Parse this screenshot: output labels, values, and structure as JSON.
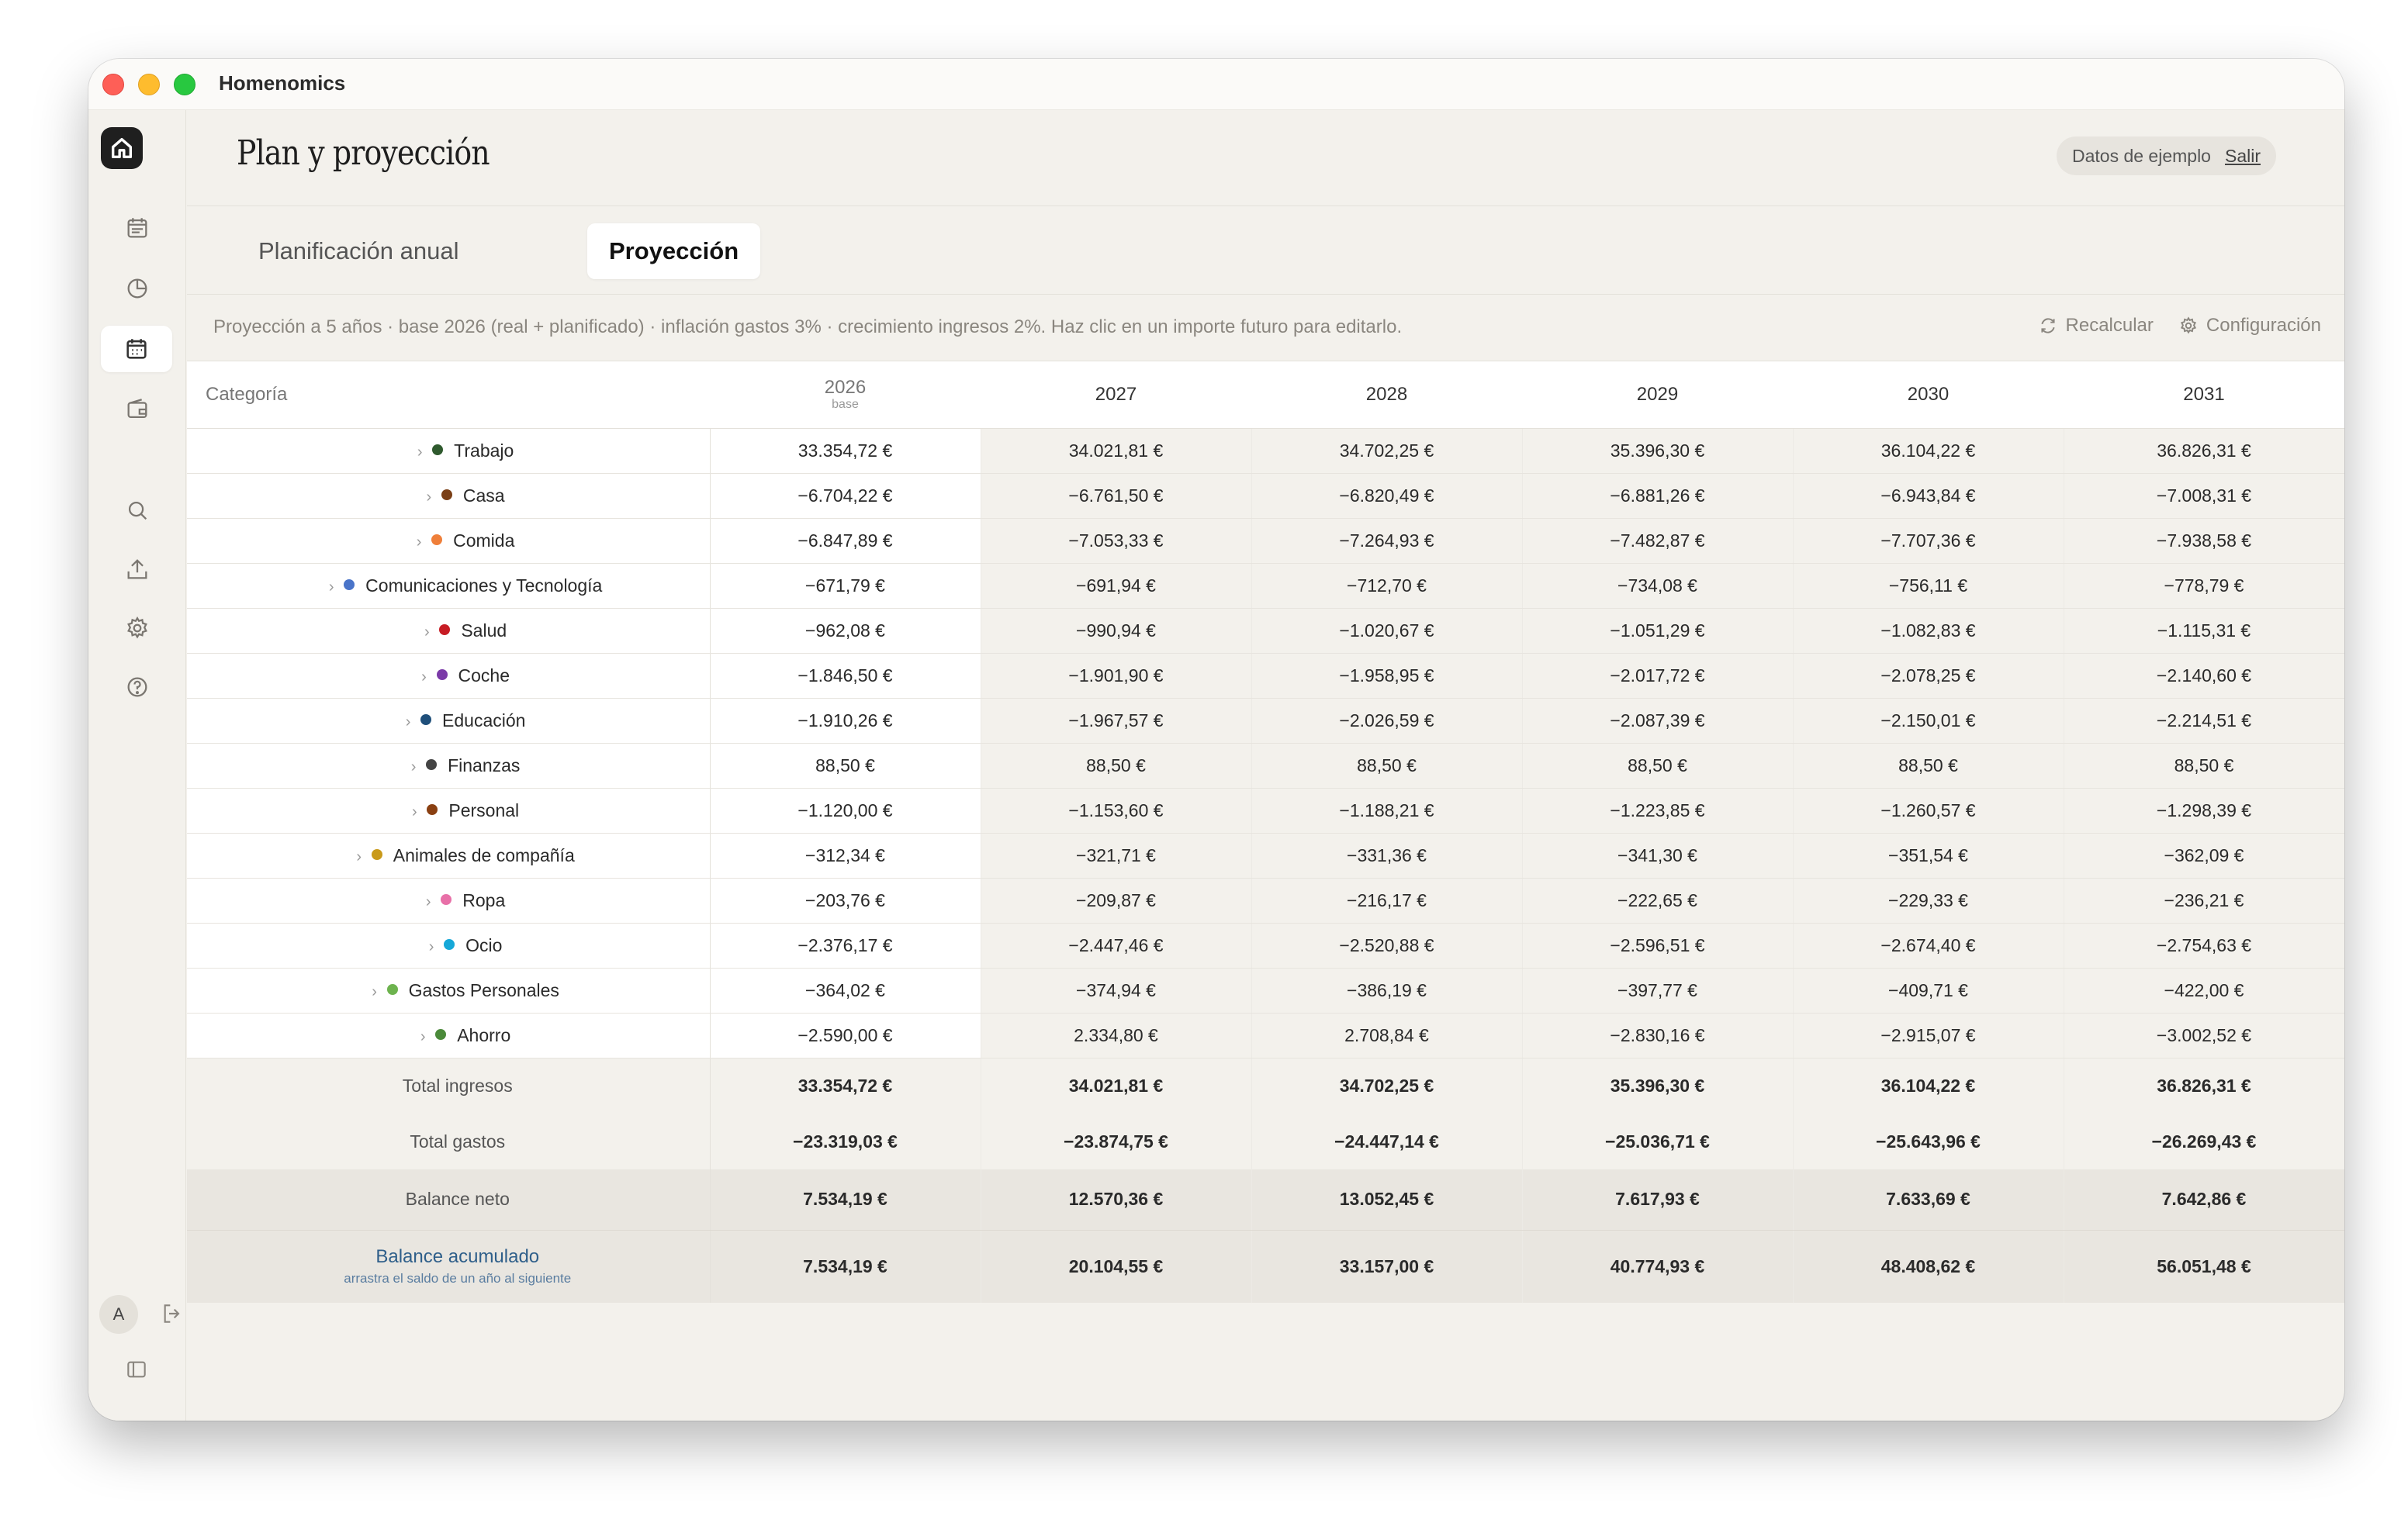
{
  "app": {
    "title": "Homenomics"
  },
  "header": {
    "page_title": "Plan y proyección",
    "sample_label": "Datos de ejemplo",
    "exit_label": "Salir"
  },
  "tabs": [
    {
      "label": "Planificación anual",
      "active": false
    },
    {
      "label": "Proyección",
      "active": true
    }
  ],
  "info": {
    "text": "Proyección a 5 años · base 2026 (real + planificado) · inflación gastos 3% · crecimiento ingresos 2%. Haz clic en un importe futuro para editarlo.",
    "recalc_label": "Recalcular",
    "config_label": "Configuración"
  },
  "user": {
    "initial": "A"
  },
  "table": {
    "category_header": "Categoría",
    "base_year": "2026",
    "base_sub": "base",
    "years": [
      "2027",
      "2028",
      "2029",
      "2030",
      "2031"
    ],
    "rows": [
      {
        "name": "Trabajo",
        "color": "#2f5a2e",
        "values": [
          "33.354,72 €",
          "34.021,81 €",
          "34.702,25 €",
          "35.396,30 €",
          "36.104,22 €",
          "36.826,31 €"
        ]
      },
      {
        "name": "Casa",
        "color": "#7a3f16",
        "values": [
          "−6.704,22 €",
          "−6.761,50 €",
          "−6.820,49 €",
          "−6.881,26 €",
          "−6.943,84 €",
          "−7.008,31 €"
        ]
      },
      {
        "name": "Comida",
        "color": "#ef7f3a",
        "values": [
          "−6.847,89 €",
          "−7.053,33 €",
          "−7.264,93 €",
          "−7.482,87 €",
          "−7.707,36 €",
          "−7.938,58 €"
        ]
      },
      {
        "name": "Comunicaciones y Tecnología",
        "color": "#4a74c9",
        "values": [
          "−671,79 €",
          "−691,94 €",
          "−712,70 €",
          "−734,08 €",
          "−756,11 €",
          "−778,79 €"
        ]
      },
      {
        "name": "Salud",
        "color": "#c71c24",
        "values": [
          "−962,08 €",
          "−990,94 €",
          "−1.020,67 €",
          "−1.051,29 €",
          "−1.082,83 €",
          "−1.115,31 €"
        ]
      },
      {
        "name": "Coche",
        "color": "#7b3aa8",
        "values": [
          "−1.846,50 €",
          "−1.901,90 €",
          "−1.958,95 €",
          "−2.017,72 €",
          "−2.078,25 €",
          "−2.140,60 €"
        ]
      },
      {
        "name": "Educación",
        "color": "#1f4f7a",
        "values": [
          "−1.910,26 €",
          "−1.967,57 €",
          "−2.026,59 €",
          "−2.087,39 €",
          "−2.150,01 €",
          "−2.214,51 €"
        ]
      },
      {
        "name": "Finanzas",
        "color": "#444444",
        "values": [
          "88,50 €",
          "88,50 €",
          "88,50 €",
          "88,50 €",
          "88,50 €",
          "88,50 €"
        ]
      },
      {
        "name": "Personal",
        "color": "#8a4012",
        "values": [
          "−1.120,00 €",
          "−1.153,60 €",
          "−1.188,21 €",
          "−1.223,85 €",
          "−1.260,57 €",
          "−1.298,39 €"
        ]
      },
      {
        "name": "Animales de compañía",
        "color": "#c99a1a",
        "values": [
          "−312,34 €",
          "−321,71 €",
          "−331,36 €",
          "−341,30 €",
          "−351,54 €",
          "−362,09 €"
        ]
      },
      {
        "name": "Ropa",
        "color": "#e870a8",
        "values": [
          "−203,76 €",
          "−209,87 €",
          "−216,17 €",
          "−222,65 €",
          "−229,33 €",
          "−236,21 €"
        ]
      },
      {
        "name": "Ocio",
        "color": "#16a8d8",
        "values": [
          "−2.376,17 €",
          "−2.447,46 €",
          "−2.520,88 €",
          "−2.596,51 €",
          "−2.674,40 €",
          "−2.754,63 €"
        ]
      },
      {
        "name": "Gastos Personales",
        "color": "#6db34e",
        "values": [
          "−364,02 €",
          "−374,94 €",
          "−386,19 €",
          "−397,77 €",
          "−409,71 €",
          "−422,00 €"
        ]
      },
      {
        "name": "Ahorro",
        "color": "#4b8a3a",
        "values": [
          "−2.590,00 €",
          "2.334,80 €",
          "2.708,84 €",
          "−2.830,16 €",
          "−2.915,07 €",
          "−3.002,52 €"
        ]
      }
    ],
    "total_income": {
      "label": "Total ingresos",
      "values": [
        "33.354,72 €",
        "34.021,81 €",
        "34.702,25 €",
        "35.396,30 €",
        "36.104,22 €",
        "36.826,31 €"
      ]
    },
    "total_expenses": {
      "label": "Total gastos",
      "values": [
        "−23.319,03 €",
        "−23.874,75 €",
        "−24.447,14 €",
        "−25.036,71 €",
        "−25.643,96 €",
        "−26.269,43 €"
      ]
    },
    "net_balance": {
      "label": "Balance neto",
      "values": [
        "7.534,19 €",
        "12.570,36 €",
        "13.052,45 €",
        "7.617,93 €",
        "7.633,69 €",
        "7.642,86 €"
      ]
    },
    "cumulative_balance": {
      "label": "Balance acumulado",
      "sublabel": "arrastra el saldo de un año al siguiente",
      "values": [
        "7.534,19 €",
        "20.104,55 €",
        "33.157,00 €",
        "40.774,93 €",
        "48.408,62 €",
        "56.051,48 €"
      ]
    }
  },
  "colors": {
    "positive": "#1d7a4c",
    "negative": "#b2472a",
    "accent": "#2f5f8a"
  }
}
